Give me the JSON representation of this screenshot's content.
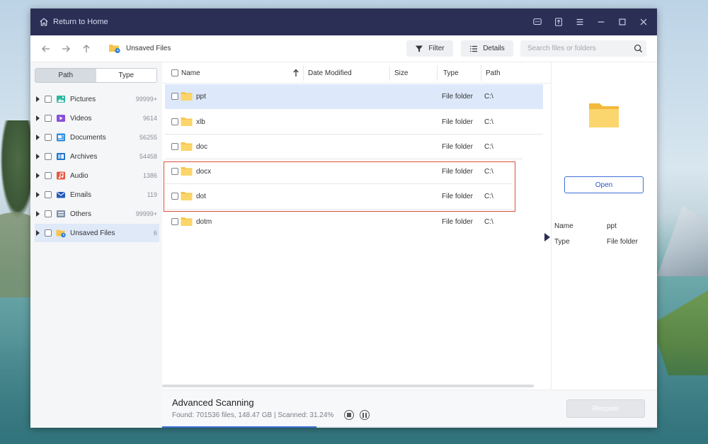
{
  "titlebar": {
    "home_label": "Return to Home",
    "controls": [
      "feedback-icon",
      "upload-icon",
      "menu-icon",
      "minimize-icon",
      "maximize-icon",
      "close-icon"
    ]
  },
  "toolbar": {
    "breadcrumb": "Unsaved Files",
    "filter_label": "Filter",
    "details_label": "Details",
    "search_placeholder": "Search files or folders"
  },
  "sidebar": {
    "tabs": [
      "Path",
      "Type"
    ],
    "active_tab": "Path",
    "items": [
      {
        "name": "Pictures",
        "count": "99999+",
        "icon": "pictures-icon"
      },
      {
        "name": "Videos",
        "count": "9614",
        "icon": "videos-icon"
      },
      {
        "name": "Documents",
        "count": "56255",
        "icon": "documents-icon"
      },
      {
        "name": "Archives",
        "count": "54458",
        "icon": "archives-icon"
      },
      {
        "name": "Audio",
        "count": "1386",
        "icon": "audio-icon"
      },
      {
        "name": "Emails",
        "count": "119",
        "icon": "emails-icon"
      },
      {
        "name": "Others",
        "count": "99999+",
        "icon": "others-icon"
      },
      {
        "name": "Unsaved Files",
        "count": "6",
        "icon": "unsaved-files-icon",
        "selected": true
      }
    ]
  },
  "list": {
    "columns": [
      "Name",
      "Date Modified",
      "Size",
      "Type",
      "Path"
    ],
    "sort_column": "Name",
    "rows": [
      {
        "name": "ppt",
        "date": "",
        "size": "",
        "type": "File folder",
        "path": "C:\\",
        "selected": true
      },
      {
        "name": "xlb",
        "date": "",
        "size": "",
        "type": "File folder",
        "path": "C:\\"
      },
      {
        "name": "doc",
        "date": "",
        "size": "",
        "type": "File folder",
        "path": "C:\\"
      },
      {
        "name": "docx",
        "date": "",
        "size": "",
        "type": "File folder",
        "path": "C:\\"
      },
      {
        "name": "dot",
        "date": "",
        "size": "",
        "type": "File folder",
        "path": "C:\\"
      },
      {
        "name": "dotm",
        "date": "",
        "size": "",
        "type": "File folder",
        "path": "C:\\"
      }
    ]
  },
  "details": {
    "open_label": "Open",
    "name_label": "Name",
    "name_value": "ppt",
    "type_label": "Type",
    "type_value": "File folder"
  },
  "footer": {
    "title": "Advanced Scanning",
    "stats": "Found: 701536 files, 148.47 GB  |  Scanned: 31.24%",
    "progress": 0.3124,
    "recover_label": "Recover"
  },
  "colors": {
    "titlebar": "#2b2f55",
    "accent": "#3d6fd6",
    "selection": "#dde9fb",
    "highlight_box": "#d9503c",
    "folder": "#f6c54f"
  }
}
